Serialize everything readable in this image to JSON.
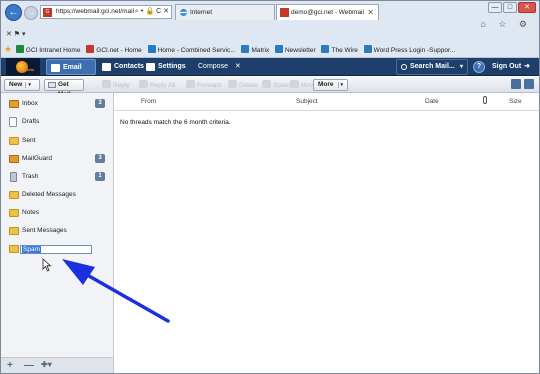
{
  "browser": {
    "address": "https://webmail.gci.net/mail",
    "address_tools": "⌕ ▾ 🔒 C ✕",
    "tabs": [
      {
        "label": "Internet",
        "close": ""
      },
      {
        "label": "demo@gci.net - Webmail",
        "close": "✕"
      }
    ],
    "window_buttons": [
      "—",
      "□",
      "✕"
    ],
    "right_icons": "⌂ ☆ ⚙",
    "command_row": "✕  ⚑ ▾",
    "favorites": [
      {
        "label": "GCI Intranet Home",
        "color": "#1e8a3a"
      },
      {
        "label": "GCI.net - Home",
        "color": "#c0392b"
      },
      {
        "label": "Home - Combined Servic...",
        "color": "#2a7bc0"
      },
      {
        "label": "Matrix",
        "color": "#2a7bc0"
      },
      {
        "label": "Newsletter",
        "color": "#2a7bc0"
      },
      {
        "label": "The Wire",
        "color": "#2a7bc0"
      },
      {
        "label": "Word Press Login -Suppor...",
        "color": "#2a7bc0"
      }
    ]
  },
  "header": {
    "logo_text": "velo",
    "email": "Email",
    "contacts": "Contacts",
    "settings": "Settings",
    "compose": "Compose",
    "compose_close": "✕",
    "search": "Search Mail...",
    "search_caret": "▾",
    "help": "?",
    "signout": "Sign Out",
    "signout_arrow": "➜"
  },
  "toolbar": {
    "new": "New",
    "new_caret": "▾",
    "get_mail": "Get Mail",
    "disabled_buttons": [
      "Reply",
      "Reply All",
      "Forward",
      "Delete",
      "Spam",
      "Move"
    ],
    "more": "More",
    "more_caret": "▾"
  },
  "folders": [
    {
      "name": "Inbox",
      "count": "3",
      "icon": "inbox-icon"
    },
    {
      "name": "Drafts",
      "count": "",
      "icon": "draft-icon"
    },
    {
      "name": "Sent",
      "count": "",
      "icon": "folder-icon"
    },
    {
      "name": "MailGuard",
      "count": "3",
      "icon": "shield-icon"
    },
    {
      "name": "Trash",
      "count": "1",
      "icon": "trash-icon"
    },
    {
      "name": "Deleted Messages",
      "count": "",
      "icon": "folder-icon"
    },
    {
      "name": "Notes",
      "count": "",
      "icon": "folder-icon"
    },
    {
      "name": "Sent Messages",
      "count": "",
      "icon": "folder-icon"
    }
  ],
  "rename_field": {
    "value": "Spam"
  },
  "sidebar_footer": {
    "add": "+",
    "remove": "—",
    "settings": "✚▾"
  },
  "list": {
    "columns": {
      "from": "From",
      "subject": "Subject",
      "date": "Date",
      "size": "Size"
    },
    "empty_message": "No threads match the 6 month criteria."
  },
  "colors": {
    "annotation_arrow": "#1a2fe0",
    "header_bg": "#1f3f6b",
    "accent": "#3d6eb0"
  }
}
